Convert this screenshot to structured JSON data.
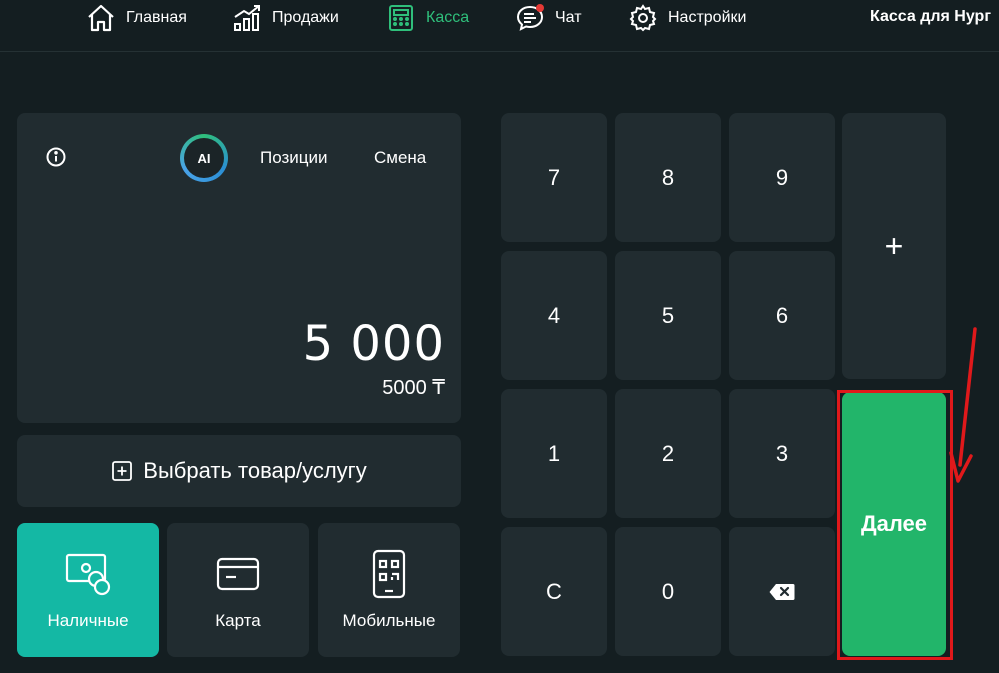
{
  "nav": {
    "items": [
      {
        "label": "Главная",
        "icon": "home-icon"
      },
      {
        "label": "Продажи",
        "icon": "sales-chart-icon"
      },
      {
        "label": "Касса",
        "icon": "calculator-icon",
        "active": true
      },
      {
        "label": "Чат",
        "icon": "chat-icon"
      },
      {
        "label": "Настройки",
        "icon": "gear-icon"
      }
    ],
    "title": "Касса для Нург"
  },
  "display": {
    "ai_label": "AI",
    "positions_label": "Позиции",
    "shift_label": "Смена",
    "amount_formatted": "5 000",
    "amount_raw": "5000 ₸"
  },
  "select_product_label": "Выбрать товар/услугу",
  "payment": {
    "cash": "Наличные",
    "card": "Карта",
    "mobile": "Мобильные"
  },
  "keypad": {
    "k7": "7",
    "k8": "8",
    "k9": "9",
    "k4": "4",
    "k5": "5",
    "k6": "6",
    "k1": "1",
    "k2": "2",
    "k3": "3",
    "clear": "C",
    "k0": "0",
    "plus": "+",
    "next": "Далее"
  },
  "colors": {
    "background": "#141e21",
    "panel": "#212c30",
    "accent_green": "#22b56a",
    "active_teal": "#14b8a4",
    "highlight_red": "#e0191b"
  }
}
